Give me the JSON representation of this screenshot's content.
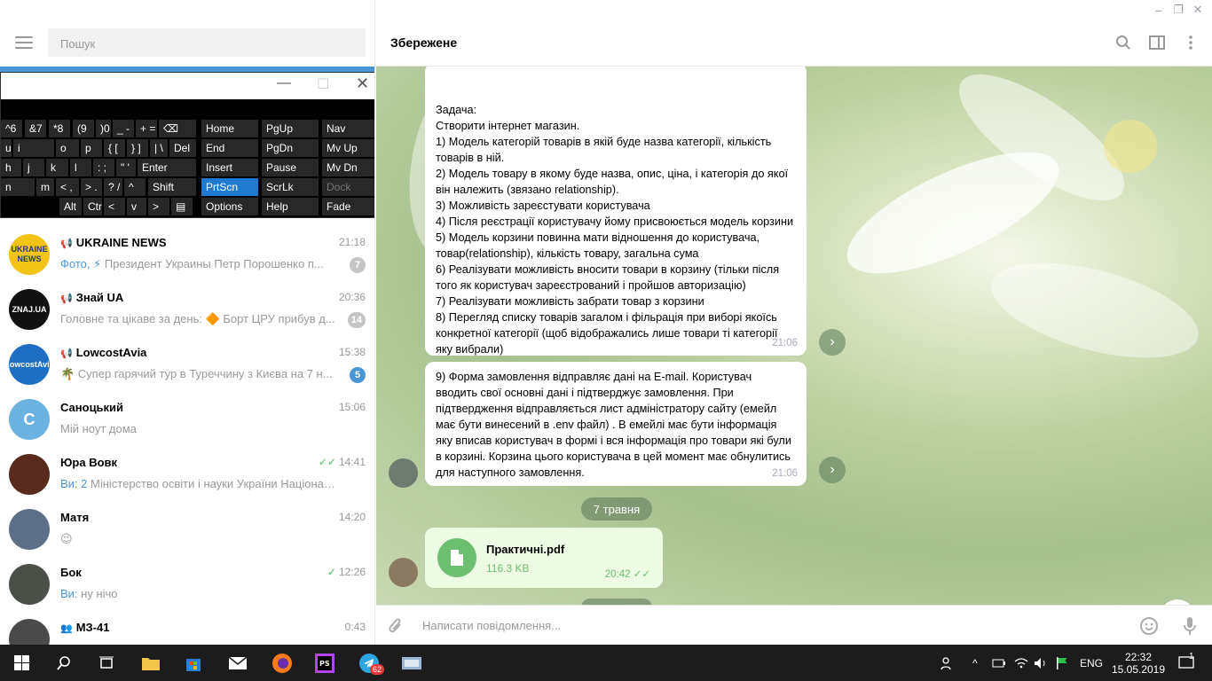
{
  "window": {
    "min": "–",
    "max": "❐",
    "close": "✕"
  },
  "sidebar": {
    "search_placeholder": "Пошук",
    "chats": [
      {
        "name": "UKRAINE NEWS",
        "time": "21:18",
        "preview_prefix": "Фото, ⚡",
        "preview": " Президент Украины Петр Порошенко п...",
        "badge": "7",
        "channel": true,
        "avatar_text": "UKRAINE NEWS",
        "avatar_color": "#f3c315"
      },
      {
        "name": "Знай UA",
        "time": "20:36",
        "preview_prefix": "",
        "preview": "Головне та цікаве за день:  🔶 Борт ЦРУ прибув д...",
        "badge": "14",
        "channel": true,
        "avatar_text": "ZNAJ.UA",
        "avatar_color": "#111111"
      },
      {
        "name": "LowcostAvia",
        "time": "15:38",
        "preview_prefix": "",
        "preview": "🌴 Супер гарячий тур в Туреччину з Києва на 7 н...",
        "badge": "5",
        "channel": true,
        "avatar_text": "LowcostAvia",
        "avatar_color": "#1e6fc4",
        "badge_active": true
      },
      {
        "name": "Саноцький",
        "time": "15:06",
        "preview_prefix": "",
        "preview": "Мій ноут дома",
        "badge": "",
        "channel": false,
        "avatar_text": "С",
        "avatar_color": "#6cb2e0"
      },
      {
        "name": "Юра Вовк",
        "time": "14:41",
        "preview_prefix": "Ви: 2",
        "preview": "   Міністерство освіти і науки України Національ...",
        "badge": "",
        "channel": false,
        "avatar_text": "",
        "avatar_color": "#5a2a1e",
        "read": "✓✓"
      },
      {
        "name": "Матя",
        "time": "14:20",
        "preview_prefix": "",
        "preview": "😉",
        "badge": "",
        "channel": false,
        "avatar_text": "",
        "avatar_color": "#5d6f86"
      },
      {
        "name": "Бок",
        "time": "12:26",
        "preview_prefix": "Ви:",
        "preview": " ну нічо",
        "badge": "",
        "channel": false,
        "avatar_text": "",
        "avatar_color": "#4a5048",
        "read": "✓"
      },
      {
        "name": "МЗ-41",
        "time": "0:43",
        "preview_prefix": "",
        "preview": "",
        "badge": "",
        "channel": false,
        "group": true,
        "avatar_text": "",
        "avatar_color": "#4a4a4a"
      }
    ]
  },
  "keyboard": {
    "rows": [
      [
        "^6",
        "&7",
        "*8",
        "(9",
        ")0",
        "_ -",
        "+ =",
        "⌫",
        "Home",
        "PgUp",
        "Nav"
      ],
      [
        "u",
        "i",
        "o",
        "p",
        "{ [",
        "} ]",
        "| \\",
        "Del",
        "End",
        "PgDn",
        "Mv Up"
      ],
      [
        "h",
        "j",
        "k",
        "l",
        ": ;",
        "\" '",
        "Enter",
        "Insert",
        "Pause",
        "Mv Dn"
      ],
      [
        "n",
        "m",
        "< ,",
        "> .",
        "? /",
        "^",
        "Shift",
        "PrtScn",
        "ScrLk",
        "Dock"
      ],
      [
        "Alt",
        "Ctrl",
        "<",
        "v",
        ">",
        "▤",
        "Options",
        "Help",
        "Fade"
      ]
    ]
  },
  "chat": {
    "title": "Збережене",
    "msg1": "Задача:\nСтворити інтернет магазин.\n1) Модель категорій товарів в якій буде назва категорії, кількість товарів в ній.\n2) Модель товару в якому буде назва, опис, ціна, і категорія до якої він належить (звязано relationship).\n3) Можливість зареєстувати користувача\n4) Після реєстрації користувачу йому присвоюється модель корзини\n5) Модель корзини повинна мати відношення до користувача, товар(relationship), кількість товару, загальна сума\n6) Реалізувати можливість вносити товари в корзину (тільки після того як користувач зареєстрований і пройшов авторизацію)\n7) Реалізувати можливість забрати товар з корзини\n8) Перегляд списку товарів загалом і фільрація при виборі якоїсь конкретної категорії (щоб відображались лише товари ті категорії яку вибрали)",
    "msg1_time": "21:06",
    "msg2": "9) Форма замовлення відправляє дані на E-mail. Користувач вводить свої основні дані і підтверджує замовлення. При підтвердження відправляється лист адміністратору сайту (емейл має бути винесений в .env файл) . В емейлі має бути інформація яку вписав користувач в формі і вся інформація про товари які були в корзині. Корзина цього користувача в цей момент має обнулитись для наступного замовлення.",
    "msg2_time": "21:06",
    "date": "7 травня",
    "file_name": "Практичні.pdf",
    "file_size": "116.3 KB",
    "file_time": "20:42",
    "file_read": "✓✓",
    "compose_placeholder": "Написати повідомлення..."
  },
  "taskbar": {
    "time": "22:32",
    "date": "15.05.2019",
    "lang": "ENG",
    "telegram_badge": "62",
    "notif_badge": "1"
  }
}
